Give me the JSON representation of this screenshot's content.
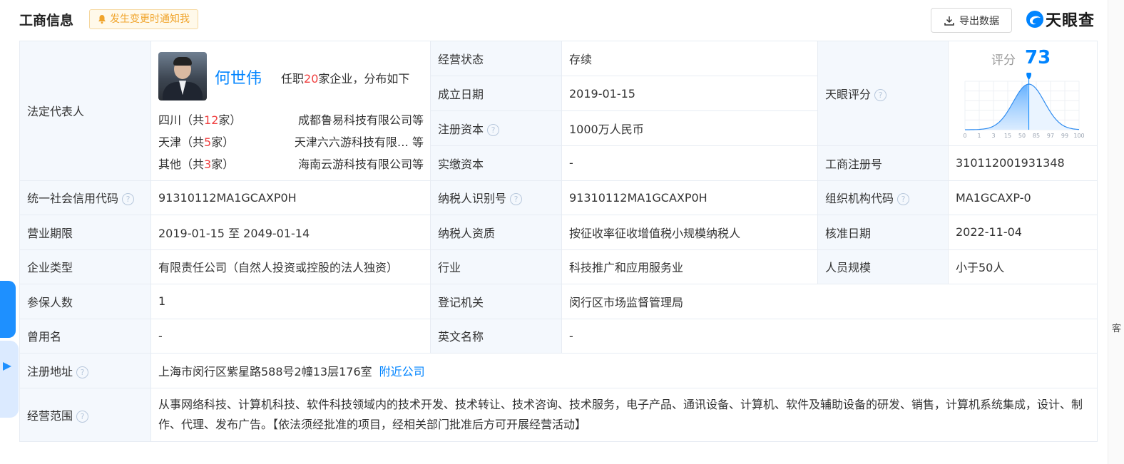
{
  "header": {
    "title": "工商信息",
    "notify_label": "发生变更时通知我",
    "export_label": "导出数据",
    "logo_text": "天眼查",
    "accent_color": "#0084ff"
  },
  "legal_rep": {
    "label": "法定代表人",
    "name": "何世伟",
    "summary_pre": "任职",
    "summary_count": "20",
    "summary_post": "家企业，分布如下",
    "regions": [
      {
        "region": "四川（共",
        "count": "12",
        "suffix": "家）",
        "company": "成都鲁易科技有限公司等"
      },
      {
        "region": "天津（共",
        "count": "5",
        "suffix": "家）",
        "company": "天津六六游科技有限…  等"
      },
      {
        "region": "其他（共",
        "count": "3",
        "suffix": "家）",
        "company": "海南云游科技有限公司等"
      }
    ]
  },
  "fields": {
    "status_label": "经营状态",
    "status_value": "存续",
    "founded_label": "成立日期",
    "founded_value": "2019-01-15",
    "reg_capital_label": "注册资本",
    "reg_capital_value": "1000万人民币",
    "paid_capital_label": "实缴资本",
    "paid_capital_value": "-",
    "score_label": "天眼评分",
    "reg_no_label": "工商注册号",
    "reg_no_value": "310112001931348",
    "credit_code_label": "统一社会信用代码",
    "credit_code_value": "91310112MA1GCAXP0H",
    "taxpayer_id_label": "纳税人识别号",
    "taxpayer_id_value": "91310112MA1GCAXP0H",
    "org_code_label": "组织机构代码",
    "org_code_value": "MA1GCAXP-0",
    "term_label": "营业期限",
    "term_value": "2019-01-15 至 2049-01-14",
    "taxpayer_qual_label": "纳税人资质",
    "taxpayer_qual_value": "按征收率征收增值税小规模纳税人",
    "approval_label": "核准日期",
    "approval_value": "2022-11-04",
    "type_label": "企业类型",
    "type_value": "有限责任公司（自然人投资或控股的法人独资）",
    "industry_label": "行业",
    "industry_value": "科技推广和应用服务业",
    "staff_label": "人员规模",
    "staff_value": "小于50人",
    "insured_label": "参保人数",
    "insured_value": "1",
    "authority_label": "登记机关",
    "authority_value": "闵行区市场监督管理局",
    "former_name_label": "曾用名",
    "former_name_value": "-",
    "english_name_label": "英文名称",
    "english_name_value": "-",
    "address_label": "注册地址",
    "address_value": "上海市闵行区紫星路588号2幢13层176室",
    "nearby_link": "附近公司",
    "scope_label": "经营范围",
    "scope_value": "从事网络科技、计算机科技、软件科技领域内的技术开发、技术转让、技术咨询、技术服务，电子产品、通讯设备、计算机、软件及辅助设备的研发、销售，计算机系统集成，设计、制作、代理、发布广告。【依法须经批准的项目，经相关部门批准后方可开展经营活动】"
  },
  "score": {
    "caption": "评分",
    "value": 73,
    "ticks": [
      "0",
      "1",
      "3",
      "15",
      "50",
      "85",
      "97",
      "99",
      "100"
    ]
  },
  "side": {
    "right_text": "客"
  }
}
